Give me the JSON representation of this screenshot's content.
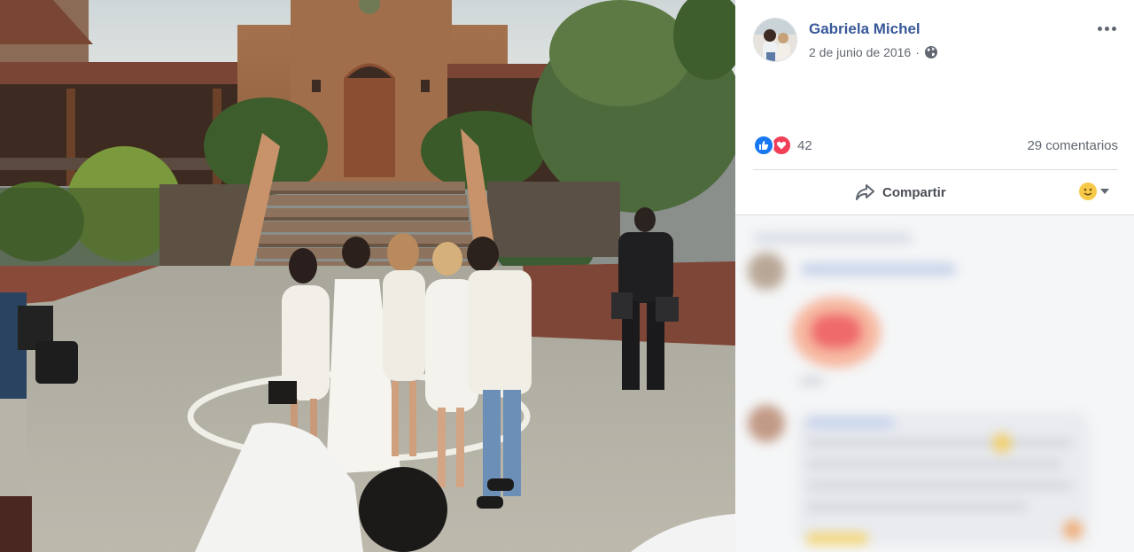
{
  "post": {
    "author": "Gabriela Michel",
    "date": "2 de junio de 2016",
    "separator": "·",
    "privacy_icon": "globe-icon"
  },
  "reactions": {
    "types": [
      "like-icon",
      "love-icon"
    ],
    "count": "42",
    "comments_label": "29 comentarios"
  },
  "actions": {
    "share_label": "Compartir",
    "share_icon": "share-arrow-icon",
    "reaction_selector_icon": "smiley-icon"
  },
  "colors": {
    "author_link": "#385898",
    "like_blue": "#1877f2",
    "love_red": "#f33e58",
    "muted_text": "#616770"
  }
}
